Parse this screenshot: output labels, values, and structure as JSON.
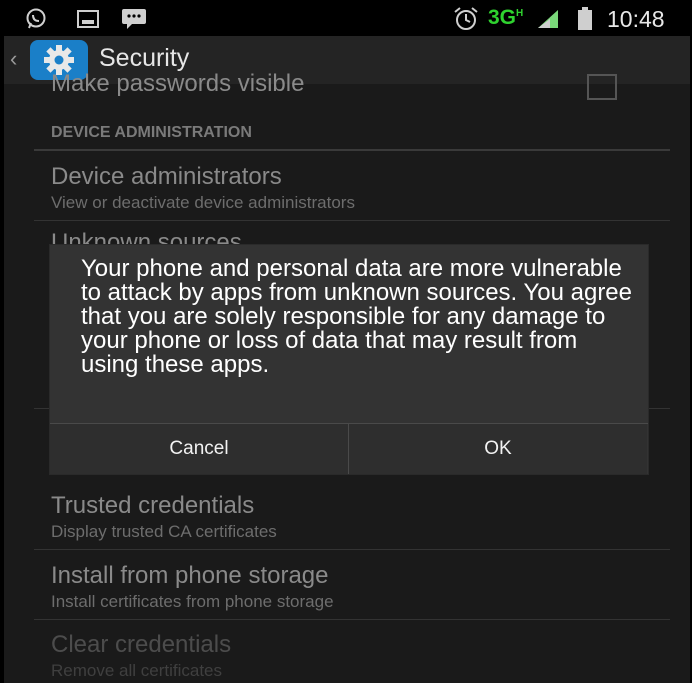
{
  "status_bar": {
    "network": "3G",
    "time": "10:48",
    "icons": [
      "whatsapp-icon",
      "image-icon",
      "message-icon",
      "alarm-icon",
      "signal-icon",
      "battery-icon"
    ]
  },
  "action_bar": {
    "title": "Security",
    "icon": "gear-icon"
  },
  "settings": {
    "partial_top": "Make passwords visible",
    "section_device_admin": "DEVICE ADMINISTRATION",
    "device_administrators": {
      "title": "Device administrators",
      "subtitle": "View or deactivate device administrators"
    },
    "unknown_sources": {
      "title": "Unknown sources"
    },
    "trusted_credentials": {
      "title": "Trusted credentials",
      "subtitle": "Display trusted CA certificates"
    },
    "install_from_storage": {
      "title": "Install from phone storage",
      "subtitle": "Install certificates from phone storage"
    },
    "clear_credentials": {
      "title": "Clear credentials",
      "subtitle": "Remove all certificates"
    }
  },
  "dialog": {
    "message": "Your phone and personal data are more vulnerable to attack by apps from unknown sources. You agree that you are solely responsible for any damage to your phone or loss of data that may result from using these apps.",
    "cancel_label": "Cancel",
    "ok_label": "OK"
  },
  "colors": {
    "accent": "#1a7fc8",
    "network_green": "#2fd22f",
    "dialog_bg": "#333333"
  }
}
